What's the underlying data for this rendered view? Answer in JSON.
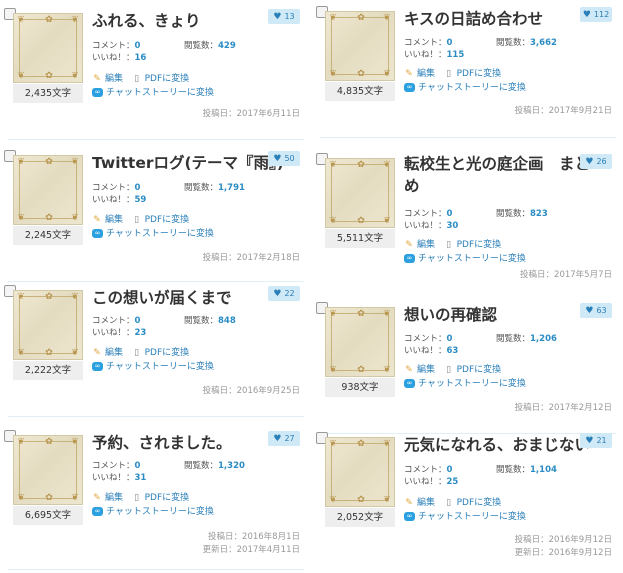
{
  "labels": {
    "comment": "コメント：",
    "views": "閲覧数：",
    "likes": "いいね！：",
    "edit": "編集",
    "pdf": "PDFに変換",
    "chat": "チャットストーリーに変換",
    "posted": "投稿日：",
    "updated": "更新日："
  },
  "stories": [
    {
      "title": "ふれる、きょり",
      "like_count": "13",
      "char_count": "2,435文字",
      "comments": "0",
      "views": "429",
      "likes": "16",
      "posted_date": "2017年6月11日"
    },
    {
      "title": "キスの日詰め合わせ",
      "like_count": "112",
      "char_count": "4,835文字",
      "comments": "0",
      "views": "3,662",
      "likes": "115",
      "posted_date": "2017年9月21日"
    },
    {
      "title": "Twitterログ(テーマ『雨』)",
      "like_count": "50",
      "char_count": "2,245文字",
      "comments": "0",
      "views": "1,791",
      "likes": "59",
      "posted_date": "2017年2月18日"
    },
    {
      "title": "転校生と光の庭企画　まとめ",
      "like_count": "26",
      "char_count": "5,511文字",
      "comments": "0",
      "views": "823",
      "likes": "30",
      "posted_date": "2017年5月7日"
    },
    {
      "title": "この想いが届くまで",
      "like_count": "22",
      "char_count": "2,222文字",
      "comments": "0",
      "views": "848",
      "likes": "23",
      "posted_date": "2016年9月25日"
    },
    {
      "title": "想いの再確認",
      "like_count": "63",
      "char_count": "938文字",
      "comments": "0",
      "views": "1,206",
      "likes": "63",
      "posted_date": "2017年2月12日"
    },
    {
      "title": "予約、されました。",
      "like_count": "27",
      "char_count": "6,695文字",
      "comments": "0",
      "views": "1,320",
      "likes": "31",
      "posted_date": "2016年8月1日",
      "updated_date": "2017年4月11日"
    },
    {
      "title": "元気になれる、おまじない",
      "like_count": "21",
      "char_count": "2,052文字",
      "comments": "0",
      "views": "1,104",
      "likes": "25",
      "posted_date": "2016年9月12日",
      "updated_date": "2016年9月12日"
    }
  ]
}
